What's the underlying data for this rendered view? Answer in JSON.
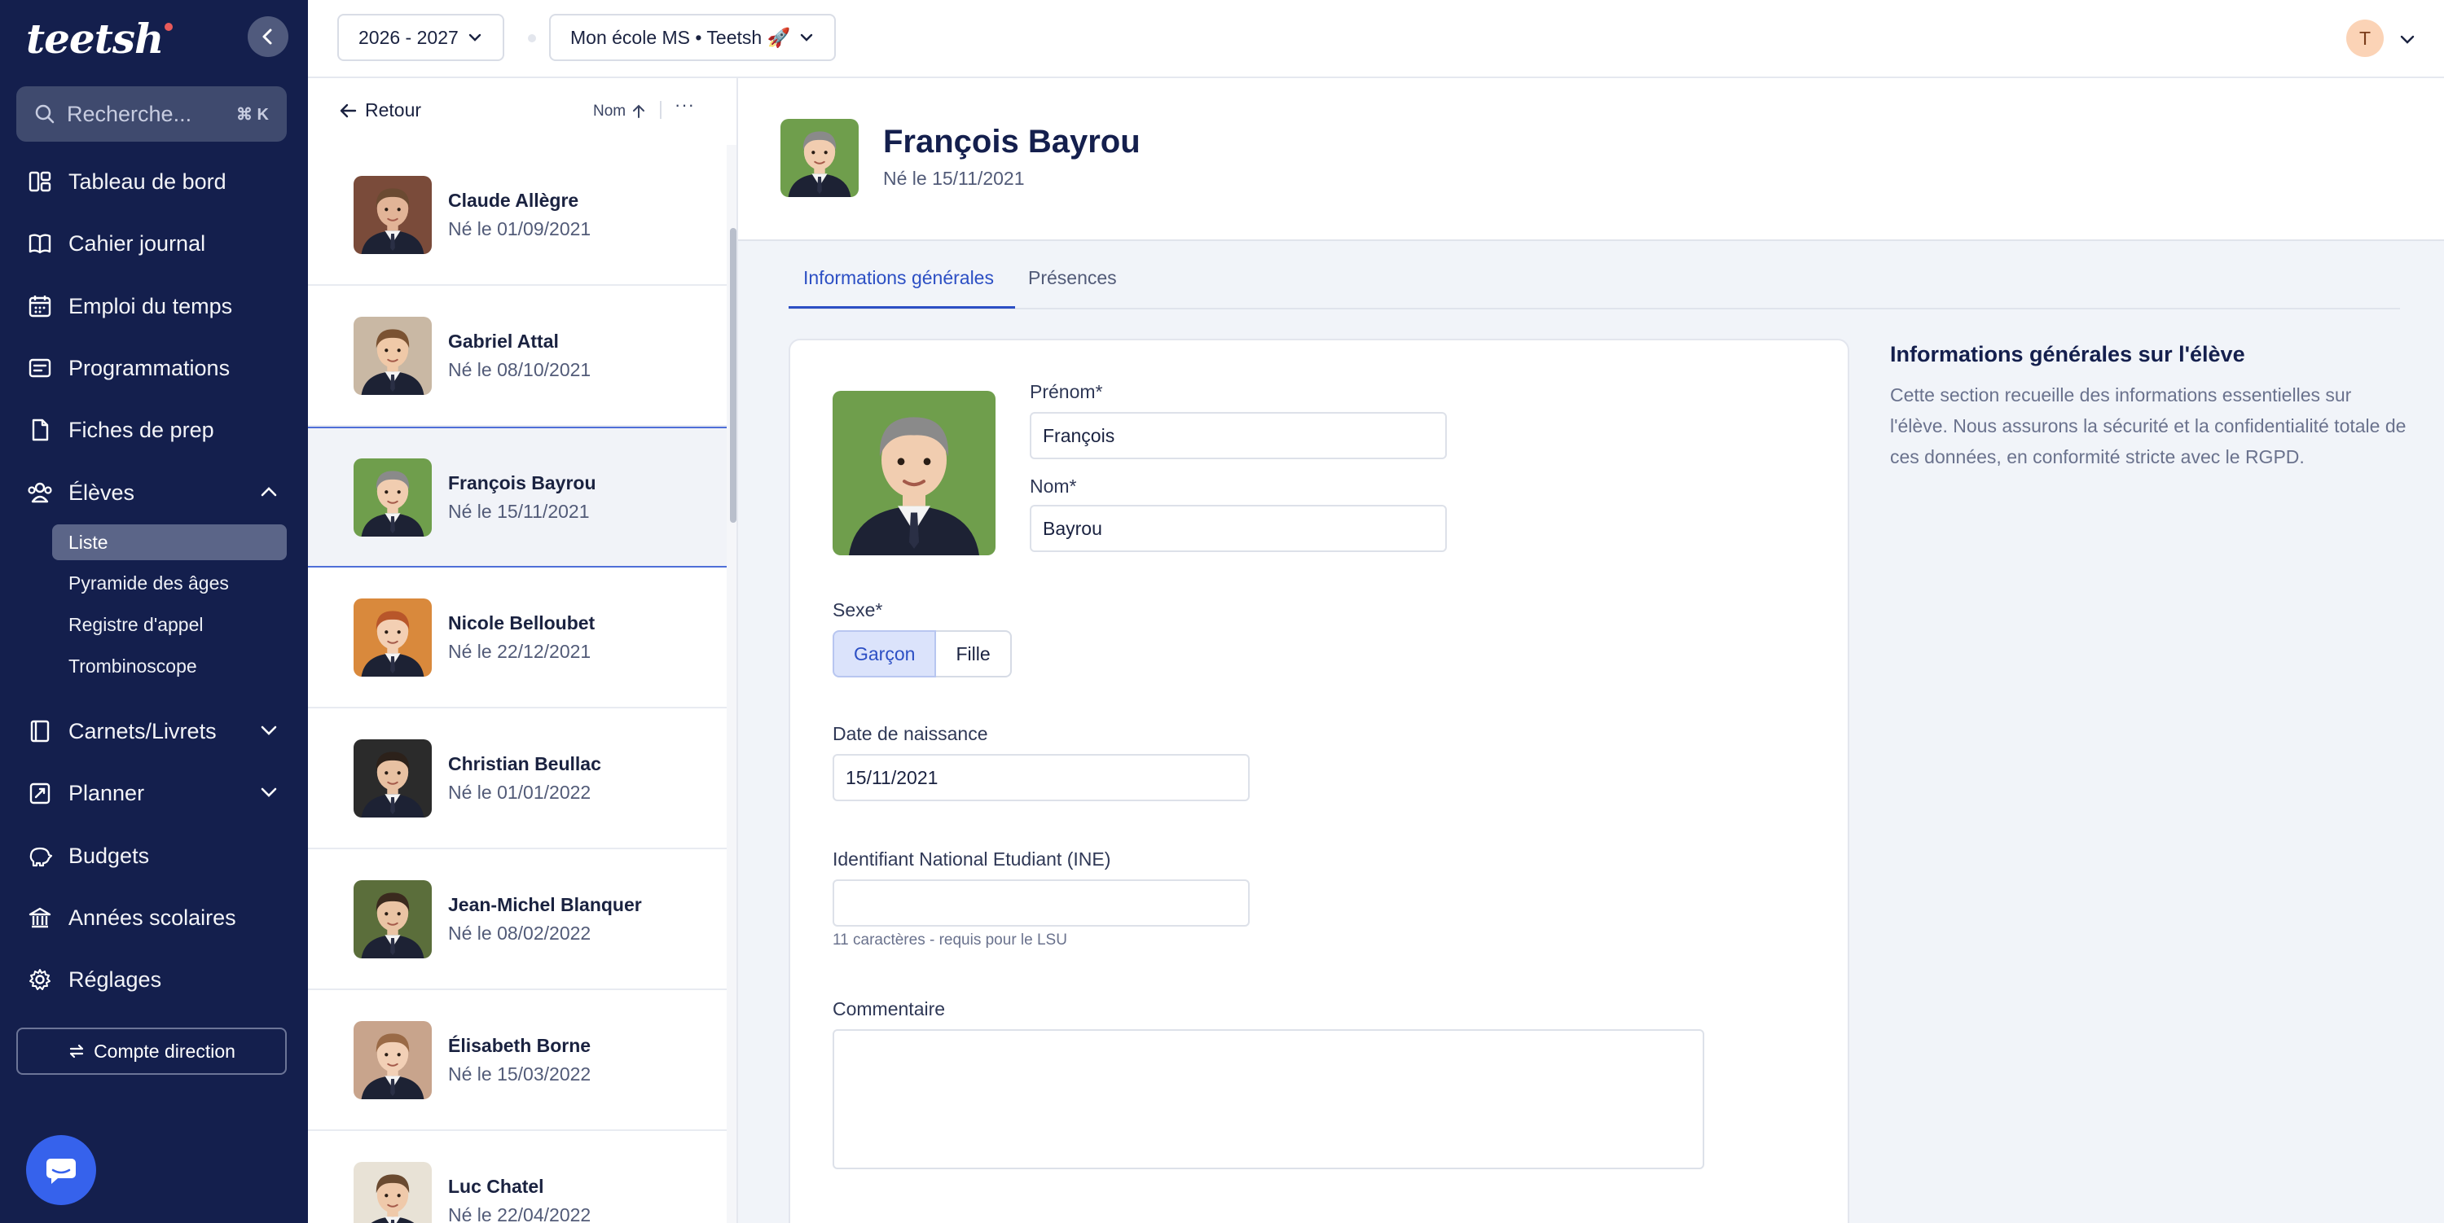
{
  "brand": {
    "logo": "teetsh"
  },
  "search": {
    "placeholder": "Recherche...",
    "shortcut": "⌘ K"
  },
  "nav": {
    "items": [
      {
        "label": "Tableau de bord",
        "icon": "dashboard-icon"
      },
      {
        "label": "Cahier journal",
        "icon": "book-icon"
      },
      {
        "label": "Emploi du temps",
        "icon": "calendar-icon"
      },
      {
        "label": "Programmations",
        "icon": "program-icon"
      },
      {
        "label": "Fiches de prep",
        "icon": "file-icon"
      },
      {
        "label": "Élèves",
        "icon": "students-icon",
        "expanded": true
      },
      {
        "label": "Carnets/Livrets",
        "icon": "notebook-icon"
      },
      {
        "label": "Planner",
        "icon": "planner-icon"
      },
      {
        "label": "Budgets",
        "icon": "piggy-bank-icon"
      },
      {
        "label": "Années scolaires",
        "icon": "school-icon"
      },
      {
        "label": "Réglages",
        "icon": "gear-icon"
      }
    ],
    "sub_items": [
      "Liste",
      "Pyramide des âges",
      "Registre d'appel",
      "Trombinoscope"
    ],
    "active_sub": "Liste",
    "direction_button": "Compte direction"
  },
  "topbar": {
    "year_selector": "2026 - 2027",
    "school_selector": "Mon école MS • Teetsh 🚀",
    "user_initial": "T"
  },
  "list": {
    "back_label": "Retour",
    "sort_label": "Nom",
    "more_label": "···",
    "students": [
      {
        "name": "Claude Allègre",
        "dob": "Né le 01/09/2021",
        "skin": "#e2b497",
        "hair": "#6b4a32",
        "bg": "#7a4b3a"
      },
      {
        "name": "Gabriel Attal",
        "dob": "Né le 08/10/2021",
        "skin": "#f0c9a8",
        "hair": "#7a5232",
        "bg": "#c9b8a4"
      },
      {
        "name": "François Bayrou",
        "dob": "Né le 15/11/2021",
        "skin": "#f1cdb0",
        "hair": "#8a8a8a",
        "bg": "#6f9e4c"
      },
      {
        "name": "Nicole Belloubet",
        "dob": "Né le 22/12/2021",
        "skin": "#f3cfb3",
        "hair": "#b8562a",
        "bg": "#d9893c"
      },
      {
        "name": "Christian Beullac",
        "dob": "Né le 01/01/2022",
        "skin": "#e8c1a2",
        "hair": "#2c211a",
        "bg": "#2b2b2b"
      },
      {
        "name": "Jean-Michel Blanquer",
        "dob": "Né le 08/02/2022",
        "skin": "#eac4a4",
        "hair": "#3a2a1e",
        "bg": "#5b6e3b"
      },
      {
        "name": "Élisabeth Borne",
        "dob": "Né le 15/03/2022",
        "skin": "#f2d0b6",
        "hair": "#9a6a46",
        "bg": "#c8a48c"
      },
      {
        "name": "Luc Chatel",
        "dob": "Né le 22/04/2022",
        "skin": "#efc9aa",
        "hair": "#6a4a30",
        "bg": "#e8e2d6"
      }
    ]
  },
  "student": {
    "name": "François Bayrou",
    "dob": "Né le 15/11/2021",
    "tabs": [
      "Informations générales",
      "Présences"
    ],
    "active_tab": "Informations générales",
    "fields": {
      "prenom_label": "Prénom*",
      "prenom_value": "François",
      "nom_label": "Nom*",
      "nom_value": "Bayrou",
      "sexe_label": "Sexe*",
      "sexe_options": [
        "Garçon",
        "Fille"
      ],
      "sexe_selected": "Garçon",
      "birth_label": "Date de naissance",
      "birth_value": "15/11/2021",
      "ine_label": "Identifiant National Etudiant (INE)",
      "ine_value": "",
      "ine_hint": "11 caractères - requis pour le LSU",
      "comment_label": "Commentaire",
      "comment_value": ""
    }
  },
  "aside": {
    "title": "Informations générales sur l'élève",
    "text": "Cette section recueille des informations essentielles sur l'élève. Nous assurons la sécurité et la confidentialité totale de ces données, en conformité stricte avec le RGPD."
  },
  "colors": {
    "sidebar": "#141f4d",
    "accent": "#2c4fc4",
    "chat": "#3662ec"
  }
}
